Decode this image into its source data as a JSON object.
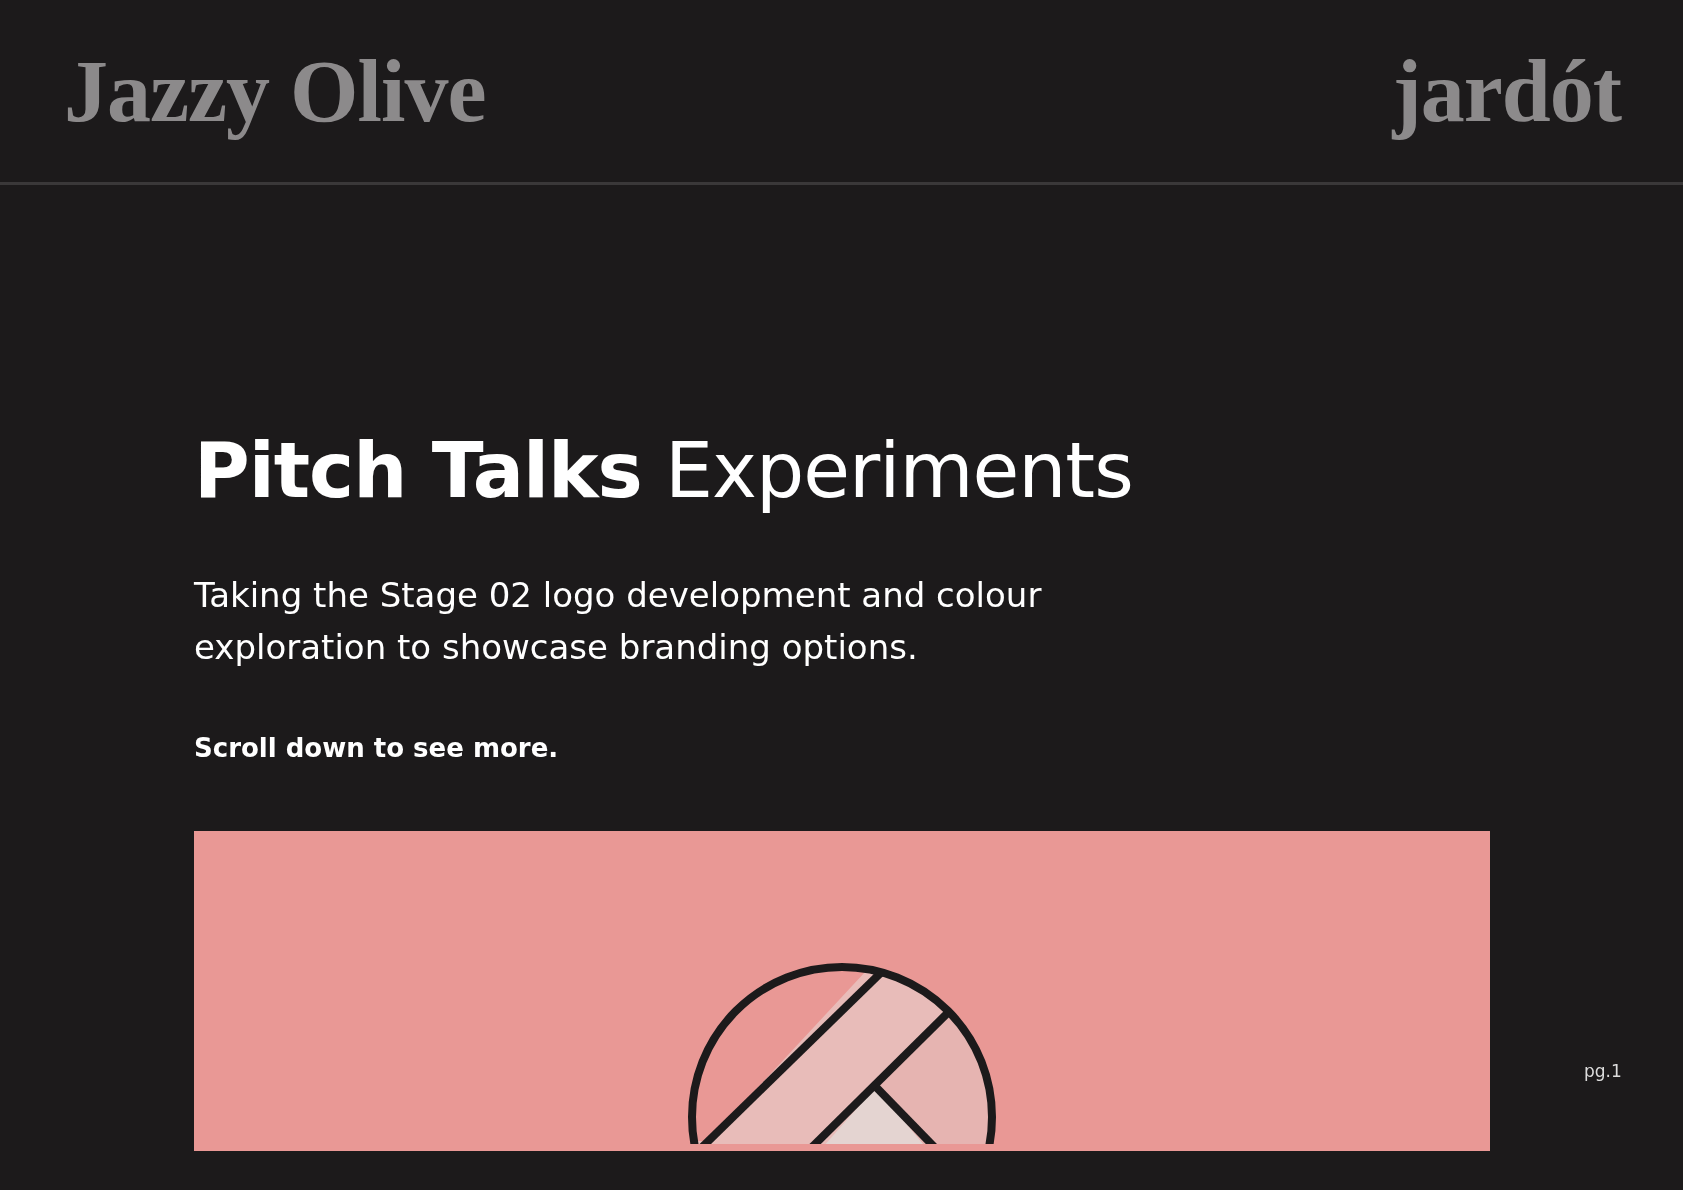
{
  "header": {
    "brand_left": "Jazzy Olive",
    "brand_right": "jardót"
  },
  "hero": {
    "title": "**Pitch Talks** Experiments",
    "description": "Taking the Stage 02 logo development and colour exploration to showcase branding options.",
    "hint": "Scroll down to see more."
  },
  "page_number": "pg.1"
}
